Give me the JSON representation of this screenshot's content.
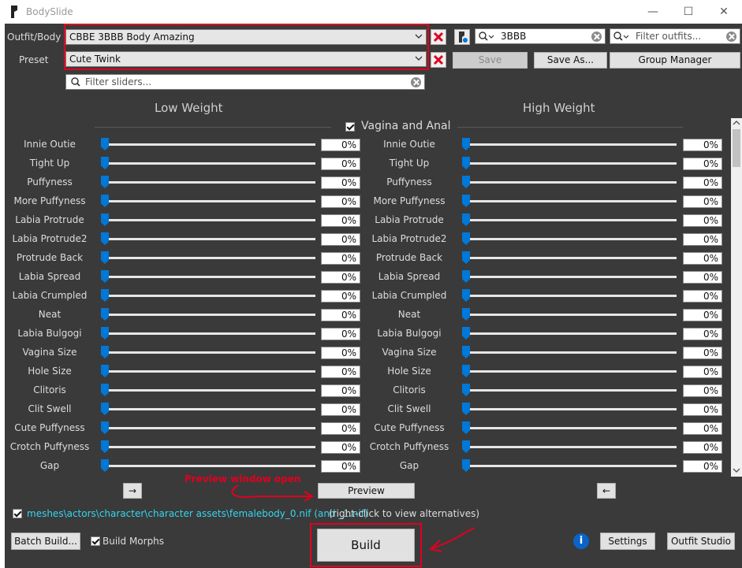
{
  "window": {
    "title": "BodySlide"
  },
  "controls": {
    "outfit_label": "Outfit/Body",
    "preset_label": "Preset"
  },
  "outfit": {
    "value": "CBBE 3BBB Body Amazing"
  },
  "preset": {
    "value": "Cute Twink"
  },
  "group_filter": {
    "value": "3BBB"
  },
  "outfit_filter": {
    "placeholder": "Filter outfits..."
  },
  "slider_filter": {
    "placeholder": "Filter sliders..."
  },
  "buttons": {
    "save": "Save",
    "save_as": "Save As...",
    "group_manager": "Group Manager",
    "preview": "Preview",
    "build": "Build",
    "batch_build": "Batch Build...",
    "settings": "Settings",
    "outfit_studio": "Outfit Studio",
    "copy_right": "→",
    "copy_left": "←"
  },
  "columns": {
    "low": "Low Weight",
    "high": "High Weight"
  },
  "category": {
    "name": "Vagina and Anal"
  },
  "sliders": [
    {
      "name": "Innie Outie",
      "low": "0%",
      "high": "0%"
    },
    {
      "name": "Tight Up",
      "low": "0%",
      "high": "0%"
    },
    {
      "name": "Puffyness",
      "low": "0%",
      "high": "0%"
    },
    {
      "name": "More Puffyness",
      "low": "0%",
      "high": "0%"
    },
    {
      "name": "Labia Protrude",
      "low": "0%",
      "high": "0%"
    },
    {
      "name": "Labia Protrude2",
      "low": "0%",
      "high": "0%"
    },
    {
      "name": "Protrude Back",
      "low": "0%",
      "high": "0%"
    },
    {
      "name": "Labia Spread",
      "low": "0%",
      "high": "0%"
    },
    {
      "name": "Labia Crumpled",
      "low": "0%",
      "high": "0%"
    },
    {
      "name": "Neat",
      "low": "0%",
      "high": "0%"
    },
    {
      "name": "Labia Bulgogi",
      "low": "0%",
      "high": "0%"
    },
    {
      "name": "Vagina Size",
      "low": "0%",
      "high": "0%"
    },
    {
      "name": "Hole Size",
      "low": "0%",
      "high": "0%"
    },
    {
      "name": "Clitoris",
      "low": "0%",
      "high": "0%"
    },
    {
      "name": "Clit Swell",
      "low": "0%",
      "high": "0%"
    },
    {
      "name": "Cute Puffyness",
      "low": "0%",
      "high": "0%"
    },
    {
      "name": "Crotch Puffyness",
      "low": "0%",
      "high": "0%"
    },
    {
      "name": "Gap",
      "low": "0%",
      "high": "0%"
    }
  ],
  "output": {
    "path": "meshes\\actors\\character\\character assets\\femalebody_0.nif (and _1.nif)",
    "hint": "(right-click to view alternatives)"
  },
  "options": {
    "build_morphs": "Build Morphs"
  },
  "annotation": {
    "text": "Preview window open"
  },
  "colors": {
    "accent": "#0078d7",
    "highlight": "#e1001e",
    "path": "#33d6f0"
  }
}
